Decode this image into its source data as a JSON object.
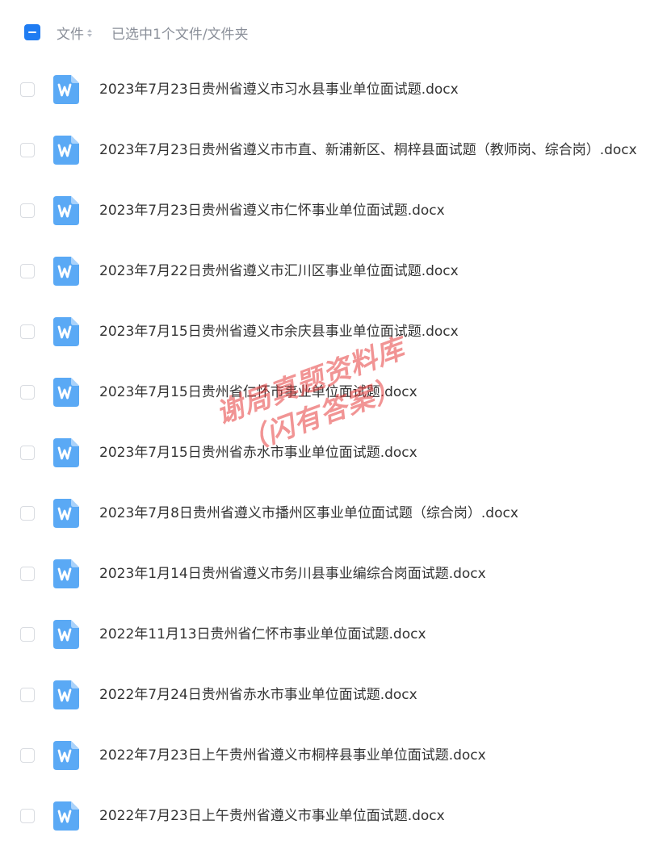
{
  "header": {
    "file_label": "文件",
    "selection_status": "已选中1个文件/文件夹"
  },
  "icons": {
    "checkbox_partial": "minus-square-icon",
    "sort": "sort-icon",
    "file_type": "word-doc-icon"
  },
  "colors": {
    "accent": "#1f7cf2",
    "doc_icon": "#5aa9f5",
    "watermark": "#e63c3c"
  },
  "files": [
    {
      "name": "2023年7月23日贵州省遵义市习水县事业单位面试题.docx"
    },
    {
      "name": "2023年7月23日贵州省遵义市市直、新浦新区、桐梓县面试题（教师岗、综合岗）.docx"
    },
    {
      "name": "2023年7月23日贵州省遵义市仁怀事业单位面试题.docx"
    },
    {
      "name": "2023年7月22日贵州省遵义市汇川区事业单位面试题.docx"
    },
    {
      "name": "2023年7月15日贵州省遵义市余庆县事业单位面试题.docx"
    },
    {
      "name": "2023年7月15日贵州省仁怀市事业单位面试题.docx"
    },
    {
      "name": "2023年7月15日贵州省赤水市事业单位面试题.docx"
    },
    {
      "name": "2023年7月8日贵州省遵义市播州区事业单位面试题（综合岗）.docx"
    },
    {
      "name": "2023年1月14日贵州省遵义市务川县事业编综合岗面试题.docx"
    },
    {
      "name": "2022年11月13日贵州省仁怀市事业单位面试题.docx"
    },
    {
      "name": "2022年7月24日贵州省赤水市事业单位面试题.docx"
    },
    {
      "name": "2022年7月23日上午贵州省遵义市桐梓县事业单位面试题.docx"
    },
    {
      "name": "2022年7月23日上午贵州省遵义市事业单位面试题.docx"
    }
  ],
  "watermark": {
    "line1": "谢局真题资料库",
    "line2": "（闪有答案）"
  }
}
